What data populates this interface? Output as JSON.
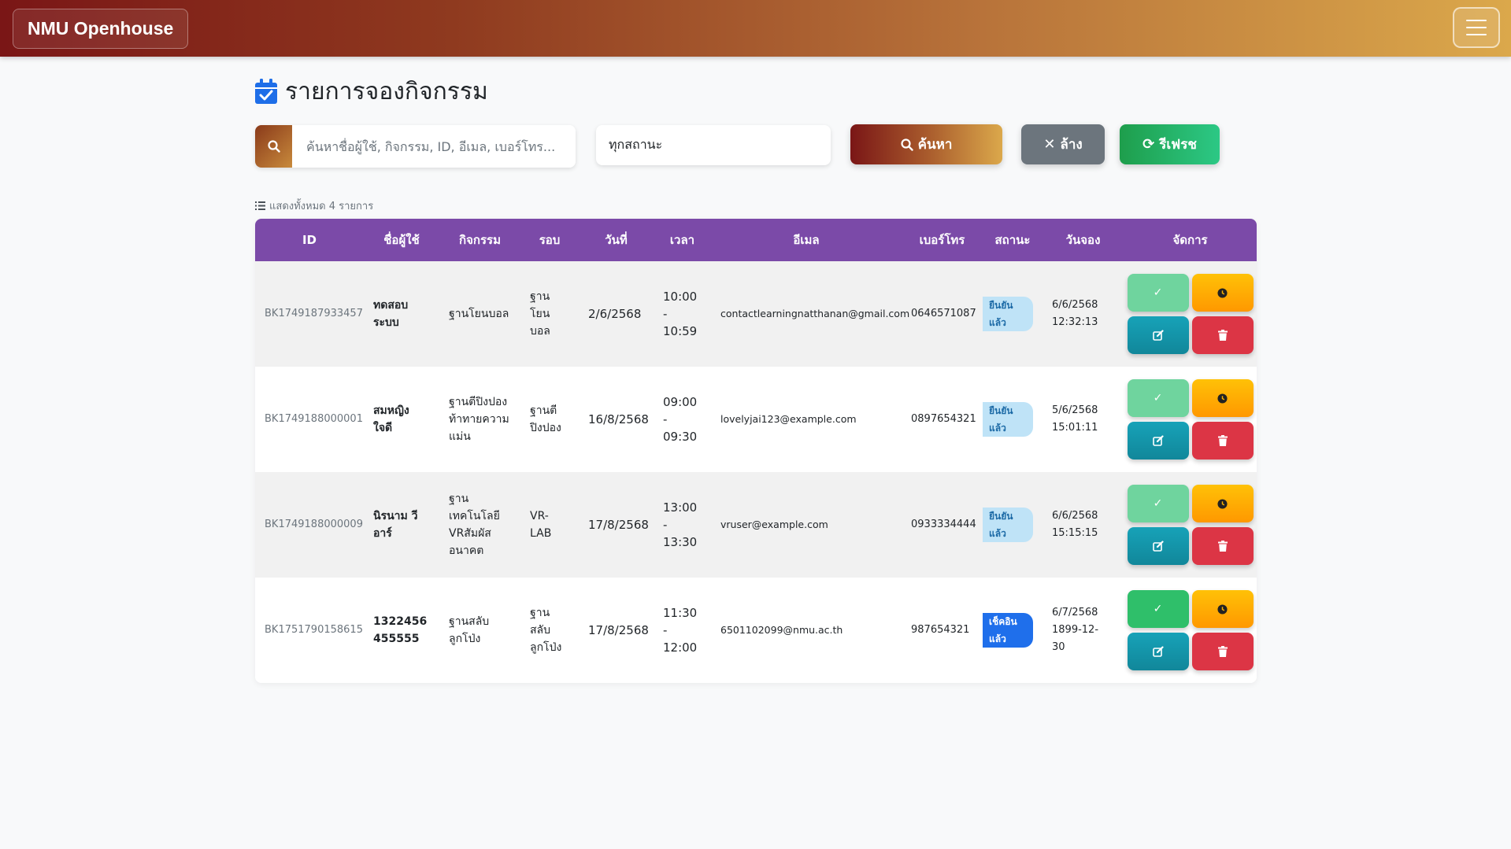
{
  "navbar": {
    "brand": "NMU Openhouse"
  },
  "page": {
    "title": "รายการจองกิจกรรม"
  },
  "filters": {
    "search_placeholder": "ค้นหาชื่อผู้ใช้, กิจกรรม, ID, อีเมล, เบอร์โทร...",
    "status_value": "ทุกสถานะ",
    "search_label": "ค้นหา",
    "clear_label": "ล้าง",
    "refresh_label": "รีเฟรช"
  },
  "summary": {
    "count_text": "แสดงทั้งหมด 4 รายการ"
  },
  "table": {
    "headers": {
      "id": "ID",
      "name": "ชื่อผู้ใช้",
      "activity": "กิจกรรม",
      "round": "รอบ",
      "date": "วันที่",
      "time": "เวลา",
      "email": "อีเมล",
      "phone": "เบอร์โทร",
      "status": "สถานะ",
      "booked": "วันจอง",
      "actions": "จัดการ"
    },
    "rows": [
      {
        "id": "BK1749187933457",
        "name": "ทดสอบ ระบบ",
        "activity": "ฐานโยนบอล",
        "round": "ฐานโยน บอล",
        "date": "2/6/2568",
        "time": "10:00 - 10:59",
        "email": "contactlearningnatthanan@gmail.com",
        "phone": "0646571087",
        "status": "ยืนยัน แล้ว",
        "status_type": "confirmed",
        "booked": "6/6/2568 12:32:13"
      },
      {
        "id": "BK1749188000001",
        "name": "สมหญิง ใจดี",
        "activity": "ฐานตีปิงปอง ท้าทายความ แม่น",
        "round": "ฐานตี ปิงปอง",
        "date": "16/8/2568",
        "time": "09:00 - 09:30",
        "email": "lovelyjai123@example.com",
        "phone": "0897654321",
        "status": "ยืนยัน แล้ว",
        "status_type": "confirmed",
        "booked": "5/6/2568 15:01:11"
      },
      {
        "id": "BK1749188000009",
        "name": "นิรนาม วี อาร์",
        "activity": "ฐานเทคโนโลยี VRสัมผัส อนาคต",
        "round": "VR-LAB",
        "date": "17/8/2568",
        "time": "13:00 - 13:30",
        "email": "vruser@example.com",
        "phone": "0933334444",
        "status": "ยืนยัน แล้ว",
        "status_type": "confirmed",
        "booked": "6/6/2568 15:15:15"
      },
      {
        "id": "BK1751790158615",
        "name": "1322456 455555",
        "activity": "ฐานสลับ ลูกโป่ง",
        "round": "ฐานสลับ ลูกโป่ง",
        "date": "17/8/2568",
        "time": "11:30 - 12:00",
        "email": "6501102099@nmu.ac.th",
        "phone": "987654321",
        "status": "เช็คอิน แล้ว",
        "status_type": "checkedin",
        "booked": "6/7/2568 1899-12- 30"
      }
    ]
  },
  "colors": {
    "navbar_start": "#7a1616",
    "navbar_end": "#dba84b",
    "table_header": "#7b4aa8",
    "confirm_btn": "#2fbf6a",
    "waiting_btn": "#ff9800",
    "edit_btn": "#17a2b8",
    "delete_btn": "#dc3545"
  },
  "icons": {
    "title": "calendar-check-icon",
    "search": "search-icon",
    "clear": "x-icon",
    "refresh": "refresh-icon",
    "list": "list-icon",
    "confirm": "check-icon",
    "waiting": "clock-icon",
    "edit": "edit-icon",
    "delete": "trash-icon"
  }
}
